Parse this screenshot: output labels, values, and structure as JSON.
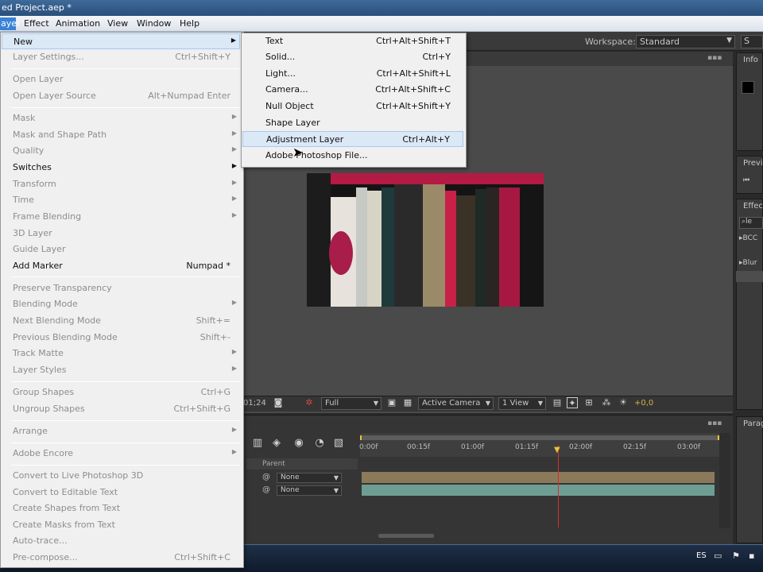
{
  "window": {
    "title": "ed Project.aep *"
  },
  "menubar": [
    {
      "label": "ayer",
      "active": true
    },
    {
      "label": "Effect"
    },
    {
      "label": "Animation"
    },
    {
      "label": "View"
    },
    {
      "label": "Window"
    },
    {
      "label": "Help"
    }
  ],
  "workspace": {
    "label": "Workspace:",
    "value": "Standard",
    "search": "S"
  },
  "layer_menu": {
    "items": [
      {
        "label": "New",
        "shortcut": "",
        "submenu": true,
        "disabled": false,
        "highlight": true
      },
      {
        "label": "Layer Settings...",
        "shortcut": "Ctrl+Shift+Y",
        "disabled": true
      },
      {
        "label": "Open Layer",
        "shortcut": "",
        "disabled": true
      },
      {
        "label": "Open Layer Source",
        "shortcut": "Alt+Numpad Enter",
        "disabled": true
      },
      {
        "label": "Mask",
        "shortcut": "",
        "submenu": true,
        "disabled": true
      },
      {
        "label": "Mask and Shape Path",
        "shortcut": "",
        "submenu": true,
        "disabled": true
      },
      {
        "label": "Quality",
        "shortcut": "",
        "submenu": true,
        "disabled": true
      },
      {
        "label": "Switches",
        "shortcut": "",
        "submenu": true,
        "disabled": false
      },
      {
        "label": "Transform",
        "shortcut": "",
        "submenu": true,
        "disabled": true
      },
      {
        "label": "Time",
        "shortcut": "",
        "submenu": true,
        "disabled": true
      },
      {
        "label": "Frame Blending",
        "shortcut": "",
        "submenu": true,
        "disabled": true
      },
      {
        "label": "3D Layer",
        "shortcut": "",
        "disabled": true
      },
      {
        "label": "Guide Layer",
        "shortcut": "",
        "disabled": true
      },
      {
        "label": "Add Marker",
        "shortcut": "Numpad *",
        "disabled": false
      },
      {
        "label": "Preserve Transparency",
        "shortcut": "",
        "disabled": true
      },
      {
        "label": "Blending Mode",
        "shortcut": "",
        "submenu": true,
        "disabled": true
      },
      {
        "label": "Next Blending Mode",
        "shortcut": "Shift+=",
        "disabled": true
      },
      {
        "label": "Previous Blending Mode",
        "shortcut": "Shift+-",
        "disabled": true
      },
      {
        "label": "Track Matte",
        "shortcut": "",
        "submenu": true,
        "disabled": true
      },
      {
        "label": "Layer Styles",
        "shortcut": "",
        "submenu": true,
        "disabled": true
      },
      {
        "label": "Group Shapes",
        "shortcut": "Ctrl+G",
        "disabled": true
      },
      {
        "label": "Ungroup Shapes",
        "shortcut": "Ctrl+Shift+G",
        "disabled": true
      },
      {
        "label": "Arrange",
        "shortcut": "",
        "submenu": true,
        "disabled": true
      },
      {
        "label": "Adobe Encore",
        "shortcut": "",
        "submenu": true,
        "disabled": true
      },
      {
        "label": "Convert to Live Photoshop 3D",
        "shortcut": "",
        "disabled": true
      },
      {
        "label": "Convert to Editable Text",
        "shortcut": "",
        "disabled": true
      },
      {
        "label": "Create Shapes from Text",
        "shortcut": "",
        "disabled": true
      },
      {
        "label": "Create Masks from Text",
        "shortcut": "",
        "disabled": true
      },
      {
        "label": "Auto-trace...",
        "shortcut": "",
        "disabled": true
      },
      {
        "label": "Pre-compose...",
        "shortcut": "Ctrl+Shift+C",
        "disabled": true
      }
    ]
  },
  "new_submenu": {
    "items": [
      {
        "label": "Text",
        "shortcut": "Ctrl+Alt+Shift+T"
      },
      {
        "label": "Solid...",
        "shortcut": "Ctrl+Y"
      },
      {
        "label": "Light...",
        "shortcut": "Ctrl+Alt+Shift+L"
      },
      {
        "label": "Camera...",
        "shortcut": "Ctrl+Alt+Shift+C"
      },
      {
        "label": "Null Object",
        "shortcut": "Ctrl+Alt+Shift+Y"
      },
      {
        "label": "Shape Layer",
        "shortcut": ""
      },
      {
        "label": "Adjustment Layer",
        "shortcut": "Ctrl+Alt+Y",
        "highlight": true
      },
      {
        "label": "Adobe Photoshop File...",
        "shortcut": ""
      }
    ]
  },
  "comp_viewer": {
    "timecode": "01;24",
    "resolution": "Full",
    "camera": "Active Camera",
    "views": "1 View",
    "exposure": "+0,0"
  },
  "right_panels": {
    "info": "Info",
    "preview": "Previ",
    "effects": "Effec",
    "search_value": "le",
    "effect1": "BCC",
    "effect2": "Blur",
    "paragraph": "Parag"
  },
  "timeline": {
    "ticks": [
      "0:00f",
      "00:15f",
      "01:00f",
      "01:15f",
      "02:00f",
      "02:15f",
      "03:00f"
    ],
    "parent_label": "Parent",
    "parent_values": [
      "None",
      "None"
    ]
  },
  "taskbar": {
    "language": "ES"
  },
  "colors": {
    "highlight": "#dbe8f6",
    "menubar_active": "#3a82d7",
    "playhead": "#d62e2e",
    "work_area": "#e8c23a"
  }
}
